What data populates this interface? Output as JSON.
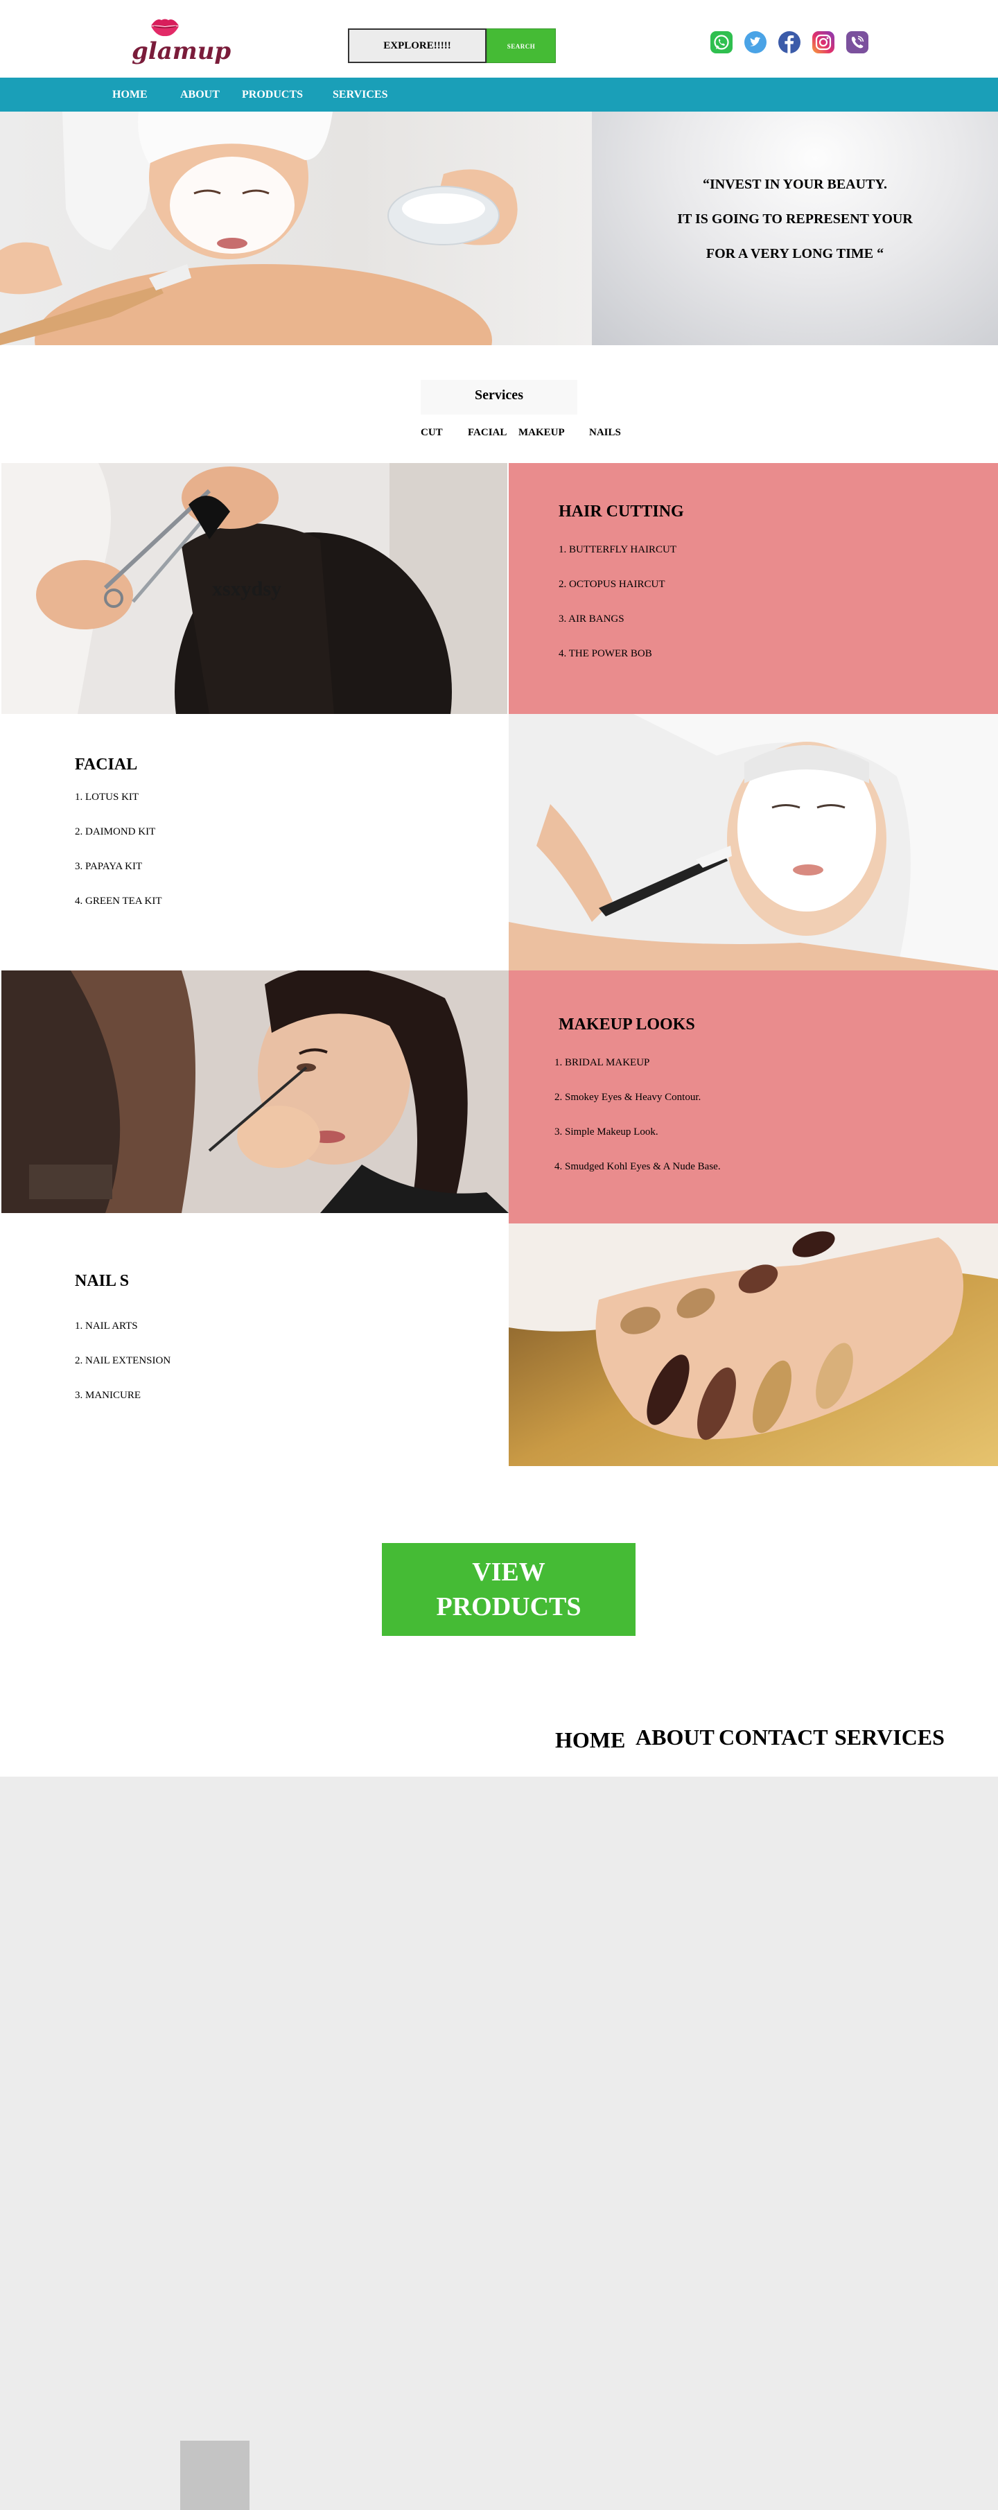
{
  "brand": {
    "logo_text": "glamup"
  },
  "search": {
    "value": "EXPLORE!!!!!",
    "button_label": "SEARCH"
  },
  "socials": [
    {
      "icon": "whatsapp-icon",
      "color": "#2fbf4f"
    },
    {
      "icon": "twitter-icon",
      "color": "#4aa3e6"
    },
    {
      "icon": "facebook-icon",
      "color": "#3b5ba9"
    },
    {
      "icon": "instagram-icon",
      "color": "#c13584"
    },
    {
      "icon": "viber-icon",
      "color": "#7b519d"
    }
  ],
  "nav": {
    "items": [
      "HOME",
      "ABOUT",
      "PRODUCTS",
      "SERVICES"
    ]
  },
  "hero": {
    "quote_lines": [
      "“INVEST IN YOUR BEAUTY.",
      "IT IS GOING TO REPRESENT YOUR",
      "FOR A VERY LONG TIME “"
    ]
  },
  "services": {
    "title": "Services",
    "tabs": [
      "CUT",
      "FACIAL",
      "MAKEUP",
      "NAILS"
    ],
    "overlay_text": "xsxydsy",
    "categories": [
      {
        "title": "HAIR CUTTING",
        "items": [
          "1. BUTTERFLY HAIRCUT",
          "2. OCTOPUS HAIRCUT",
          "3. AIR BANGS",
          "4. THE POWER BOB"
        ]
      },
      {
        "title": "FACIAL",
        "items": [
          "1. LOTUS KIT",
          "2. DAIMOND KIT",
          "3. PAPAYA KIT",
          "4. GREEN TEA KIT"
        ]
      },
      {
        "title": "MAKEUP LOOKS",
        "items": [
          "1. BRIDAL MAKEUP",
          "2. Smokey Eyes & Heavy Contour.",
          "3. Simple Makeup Look.",
          "4. Smudged Kohl Eyes & A Nude Base."
        ]
      },
      {
        "title": "NAIL S",
        "items": [
          "1. NAIL ARTS",
          "2. NAIL EXTENSION",
          "3. MANICURE"
        ]
      }
    ]
  },
  "cta": {
    "line1": "VIEW",
    "line2": "PRODUCTS"
  },
  "footer": {
    "links": [
      "HOME",
      "ABOUT",
      "CONTACT",
      "SERVICES"
    ]
  },
  "colors": {
    "nav": "#1a9fb8",
    "accent_green": "#45bb35",
    "pink": "#e98c8d",
    "background": "#ececec"
  }
}
